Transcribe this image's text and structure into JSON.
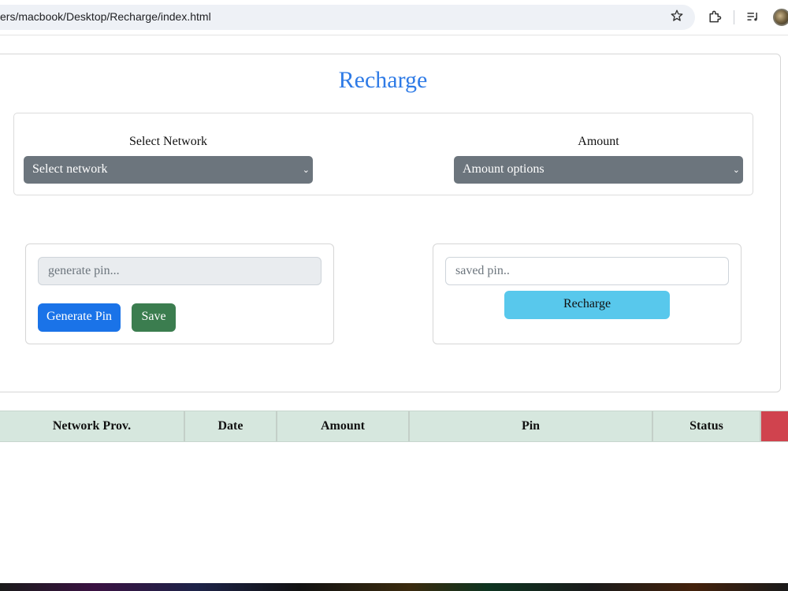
{
  "browser": {
    "url": "ers/macbook/Desktop/Recharge/index.html",
    "icons": [
      "star-icon",
      "extensions-icon",
      "media-control-icon",
      "profile-avatar"
    ]
  },
  "app": {
    "title": "Recharge",
    "select_network": {
      "label": "Select Network",
      "value": "Select network"
    },
    "amount": {
      "label": "Amount",
      "value": "Amount options"
    },
    "generate_card": {
      "pin_placeholder": "generate pin...",
      "generate_button": "Generate Pin",
      "save_button": "Save"
    },
    "recharge_card": {
      "saved_pin_placeholder": "saved pin..",
      "recharge_button": "Recharge"
    },
    "table": {
      "headers": [
        "Network Prov.",
        "Date",
        "Amount",
        "Pin",
        "Status",
        ""
      ]
    }
  },
  "colors": {
    "title": "#2f7be6",
    "select_bg": "#6c757d",
    "primary_button": "#1a73e8",
    "save_button": "#3b7d4f",
    "recharge_button": "#58c8ec",
    "table_header_bg": "#d6e7de",
    "last_header_cell": "#d0434e"
  }
}
